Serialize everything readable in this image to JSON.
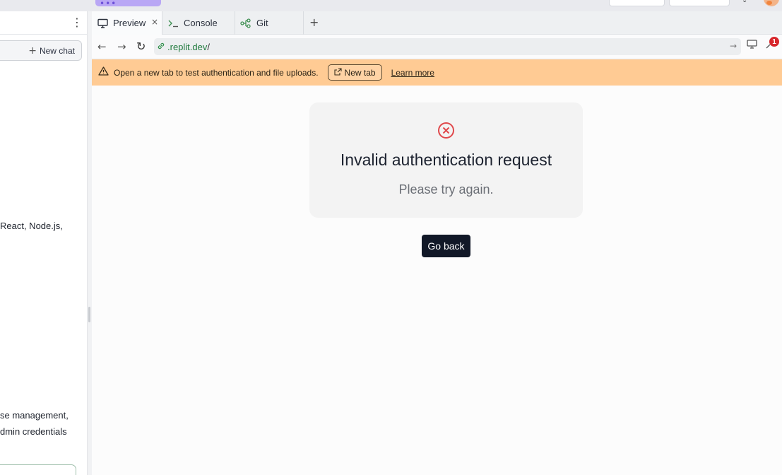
{
  "top": {
    "menu_dots": "•••",
    "chevron": "⌄"
  },
  "left_panel": {
    "menu": "⋮",
    "new_chat": {
      "icon": "+",
      "label": "New chat"
    },
    "messages": [
      "React, Node.js,",
      "se management,",
      "dmin credentials"
    ]
  },
  "tabs": [
    {
      "label": "Preview",
      "icon": "monitor-icon",
      "active": true
    },
    {
      "label": "Console",
      "icon": "terminal-icon",
      "active": false
    },
    {
      "label": "Git",
      "icon": "git-icon",
      "active": false
    }
  ],
  "tab_close": "×",
  "add_tab": "+",
  "nav": {
    "back": "←",
    "forward": "→",
    "reload": "↻",
    "url_host": ".replit.dev",
    "url_path": "/",
    "go": "→",
    "devtools_badge": "1"
  },
  "banner": {
    "message": "Open a new tab to test authentication and file uploads.",
    "new_tab_label": "New tab",
    "learn_more": "Learn more",
    "color": "#ffcb94"
  },
  "error": {
    "title": "Invalid authentication request",
    "subtitle": "Please try again.",
    "icon_color": "#e0484b",
    "button_label": "Go back"
  }
}
